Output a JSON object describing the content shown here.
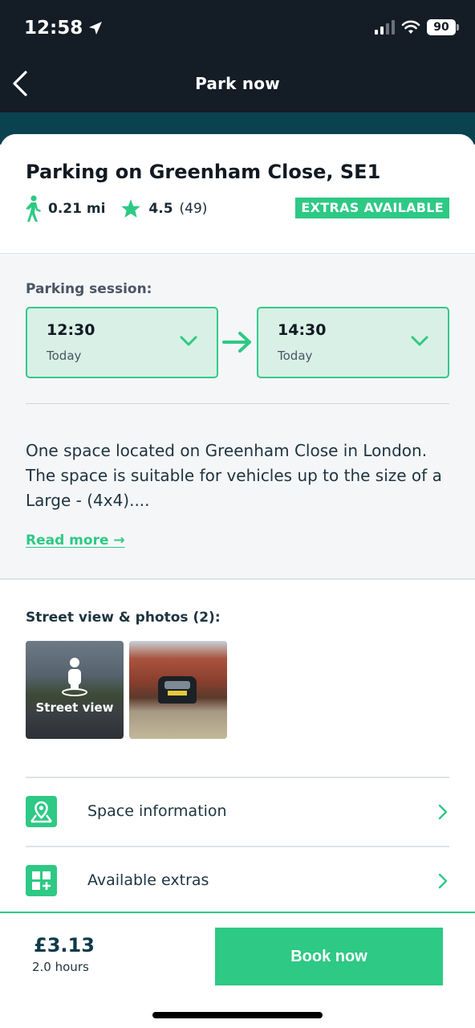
{
  "status_bar": {
    "time": "12:58",
    "battery": "90",
    "location_icon": "location-arrow-icon",
    "signal_icon": "cellular-signal-icon",
    "wifi_icon": "wifi-icon"
  },
  "nav": {
    "title": "Park now",
    "back_icon": "chevron-left-icon"
  },
  "listing": {
    "title": "Parking on Greenham Close, SE1",
    "distance": "0.21 mi",
    "rating": "4.5",
    "reviews": "(49)",
    "extras_badge": "EXTRAS AVAILABLE"
  },
  "session": {
    "label": "Parking session:",
    "start": {
      "time": "12:30",
      "day": "Today"
    },
    "end": {
      "time": "14:30",
      "day": "Today"
    }
  },
  "description": {
    "text": "One space located on Greenham Close in London. The space is suitable for vehicles up to the size of a Large - (4x4)....",
    "read_more": "Read more →"
  },
  "photos": {
    "label": "Street view & photos (2):",
    "street_view_label": "Street view"
  },
  "rows": [
    {
      "label": "Space information",
      "icon": "map-pin-icon"
    },
    {
      "label": "Available extras",
      "icon": "grid-plus-icon"
    }
  ],
  "footer": {
    "price": "£3.13",
    "duration": "2.0 hours",
    "book_label": "Book now"
  },
  "colors": {
    "accent": "#2ec985",
    "dark": "#141c26",
    "teal": "#0b4250",
    "session_bg": "#d8f0e6"
  }
}
